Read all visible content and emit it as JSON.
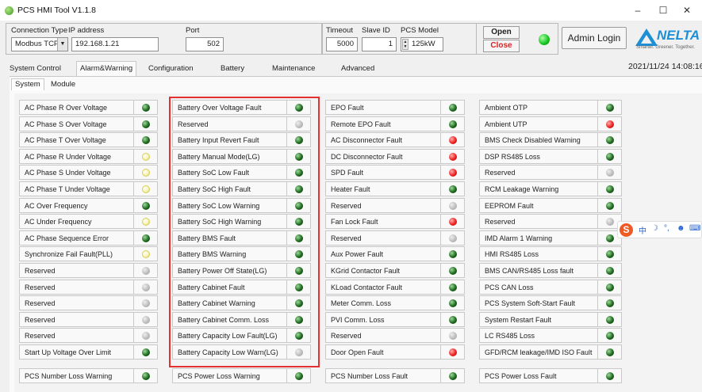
{
  "window": {
    "title": "PCS HMI Tool V1.1.8",
    "minimize": "–",
    "maximize": "☐",
    "close": "✕"
  },
  "toolbar": {
    "connection_type_label": "Connection Type",
    "connection_type_value": "Modbus TCP",
    "ip_label": "IP address",
    "ip_value": "192.168.1.21",
    "port_label": "Port",
    "port_value": "502",
    "timeout_label": "Timeout",
    "timeout_value": "5000",
    "slave_id_label": "Slave ID",
    "slave_id_value": "1",
    "pcs_model_label": "PCS Model",
    "pcs_model_value": "125kW",
    "open_label": "Open",
    "close_label": "Close",
    "admin_label": "Admin Login",
    "status_color": "#11c41a"
  },
  "logo": {
    "word": "NELTA",
    "tagline": "Smarter. Greener. Together."
  },
  "tabs": [
    "System Control",
    "Alarm&Warning",
    "Configuration",
    "Battery",
    "Maintenance",
    "Advanced"
  ],
  "active_tab": "Alarm&Warning",
  "datetime": "2021/11/24 14:08:16",
  "subtabs": [
    "System",
    "Module"
  ],
  "active_subtab": "System",
  "led_colors": {
    "green": "#1e6a1e",
    "yellow": "#f7f3b5",
    "grey": "#b9b9b9",
    "red": "#ee2222"
  },
  "columns": [
    {
      "items": [
        {
          "label": "AC Phase R Over Voltage",
          "led": "green"
        },
        {
          "label": "AC Phase S Over Voltage",
          "led": "green"
        },
        {
          "label": "AC Phase T Over Voltage",
          "led": "green"
        },
        {
          "label": "AC Phase R Under Voltage",
          "led": "yellow"
        },
        {
          "label": "AC Phase S Under Voltage",
          "led": "yellow"
        },
        {
          "label": "AC Phase T Under Voltage",
          "led": "yellow"
        },
        {
          "label": "AC Over Frequency",
          "led": "green"
        },
        {
          "label": "AC Under Frequency",
          "led": "yellow"
        },
        {
          "label": "AC Phase Sequence Error",
          "led": "green"
        },
        {
          "label": "Synchronize Fail Fault(PLL)",
          "led": "yellow"
        },
        {
          "label": "Reserved",
          "led": "grey"
        },
        {
          "label": "Reserved",
          "led": "grey"
        },
        {
          "label": "Reserved",
          "led": "grey"
        },
        {
          "label": "Reserved",
          "led": "grey"
        },
        {
          "label": "Reserved",
          "led": "grey"
        },
        {
          "label": "Start Up Voltage Over Limit",
          "led": "green"
        }
      ],
      "footer": {
        "label": "PCS Number Loss Warning",
        "led": "green"
      }
    },
    {
      "items": [
        {
          "label": "Battery Over Voltage Fault",
          "led": "green"
        },
        {
          "label": "Reserved",
          "led": "grey"
        },
        {
          "label": "Battery Input Revert Fault",
          "led": "green"
        },
        {
          "label": "Battery Manual Mode(LG)",
          "led": "green"
        },
        {
          "label": "Battery SoC Low Fault",
          "led": "green"
        },
        {
          "label": "Battery SoC High Fault",
          "led": "green"
        },
        {
          "label": "Battery SoC Low Warning",
          "led": "green"
        },
        {
          "label": "Battery SoC High Warning",
          "led": "green"
        },
        {
          "label": "Battery BMS Fault",
          "led": "green"
        },
        {
          "label": "Battery BMS Warning",
          "led": "green"
        },
        {
          "label": "Battery Power Off State(LG)",
          "led": "green"
        },
        {
          "label": "Battery Cabinet Fault",
          "led": "green"
        },
        {
          "label": "Battery Cabinet Warning",
          "led": "green"
        },
        {
          "label": "Battery Cabinet Comm. Loss",
          "led": "green"
        },
        {
          "label": "Battery Capacity Low Fault(LG)",
          "led": "green"
        },
        {
          "label": "Battery Capacity Low Warn(LG)",
          "led": "grey"
        }
      ],
      "footer": {
        "label": "PCS Power Loss Warning",
        "led": "green"
      }
    },
    {
      "items": [
        {
          "label": "EPO Fault",
          "led": "green"
        },
        {
          "label": "Remote EPO Fault",
          "led": "green"
        },
        {
          "label": "AC Disconnector Fault",
          "led": "red"
        },
        {
          "label": "DC Disconnector Fault",
          "led": "red"
        },
        {
          "label": "SPD Fault",
          "led": "red"
        },
        {
          "label": "Heater Fault",
          "led": "green"
        },
        {
          "label": "Reserved",
          "led": "grey"
        },
        {
          "label": "Fan Lock Fault",
          "led": "red"
        },
        {
          "label": "Reserved",
          "led": "grey"
        },
        {
          "label": "Aux Power Fault",
          "led": "green"
        },
        {
          "label": "KGrid Contactor Fault",
          "led": "green"
        },
        {
          "label": "KLoad Contactor Fault",
          "led": "green"
        },
        {
          "label": "Meter Comm. Loss",
          "led": "green"
        },
        {
          "label": "PVI Comm. Loss",
          "led": "green"
        },
        {
          "label": "Reserved",
          "led": "grey"
        },
        {
          "label": "Door Open Fault",
          "led": "red"
        }
      ],
      "footer": {
        "label": "PCS Number Loss Fault",
        "led": "green"
      }
    },
    {
      "items": [
        {
          "label": "Ambient OTP",
          "led": "green"
        },
        {
          "label": "Ambient UTP",
          "led": "red"
        },
        {
          "label": "BMS Check Disabled Warning",
          "led": "green"
        },
        {
          "label": "DSP RS485 Loss",
          "led": "green"
        },
        {
          "label": "Reserved",
          "led": "grey"
        },
        {
          "label": "RCM Leakage Warning",
          "led": "green"
        },
        {
          "label": "EEPROM Fault",
          "led": "green"
        },
        {
          "label": "Reserved",
          "led": "grey"
        },
        {
          "label": "IMD Alarm 1 Warning",
          "led": "green"
        },
        {
          "label": "HMI RS485 Loss",
          "led": "green"
        },
        {
          "label": "BMS CAN/RS485 Loss fault",
          "led": "green"
        },
        {
          "label": "PCS CAN Loss",
          "led": "green"
        },
        {
          "label": "PCS System Soft-Start Fault",
          "led": "green"
        },
        {
          "label": "System Restart Fault",
          "led": "green"
        },
        {
          "label": "LC RS485 Loss",
          "led": "green"
        },
        {
          "label": "GFD/RCM leakage/IMD ISO Fault",
          "led": "green"
        }
      ],
      "footer": {
        "label": "PCS Power Loss Fault",
        "led": "green"
      }
    }
  ],
  "ime": {
    "logo": "S",
    "items": [
      "中",
      "☽",
      "°,",
      "☻",
      "⌨"
    ]
  }
}
